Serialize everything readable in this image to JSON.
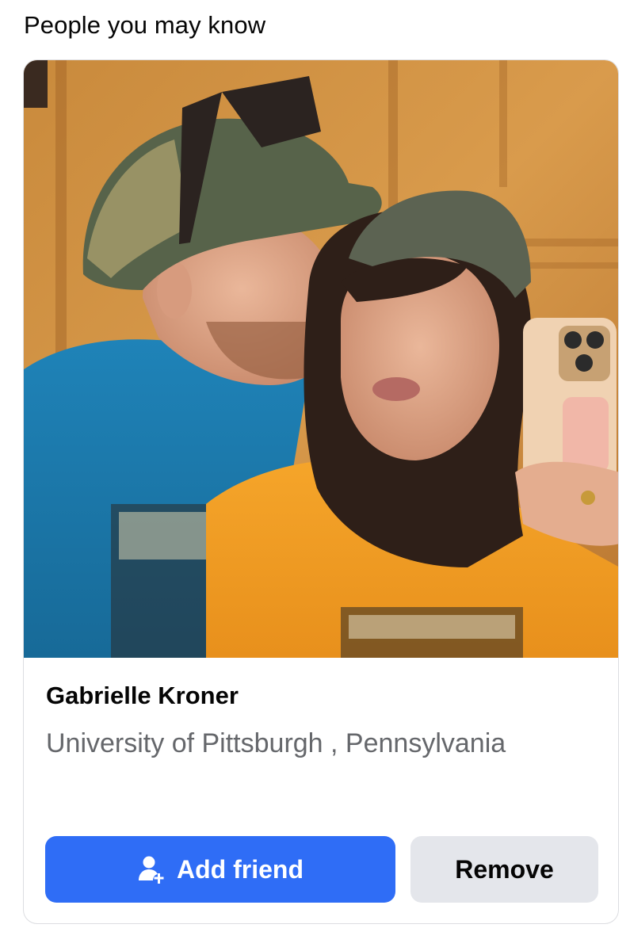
{
  "section": {
    "title": "People you may know"
  },
  "suggestion": {
    "name": "Gabrielle Kroner",
    "subtitle": "University of Pittsburgh , Pennsylvania",
    "photo_alt": "Gabrielle Kroner",
    "actions": {
      "add_friend_label": "Add friend",
      "add_friend_icon": "add-person-icon",
      "remove_label": "Remove"
    }
  },
  "colors": {
    "primary_button": "#2f6df6",
    "secondary_button": "#e4e6eb",
    "subtitle_text": "#65676b",
    "title_text": "#050505"
  }
}
